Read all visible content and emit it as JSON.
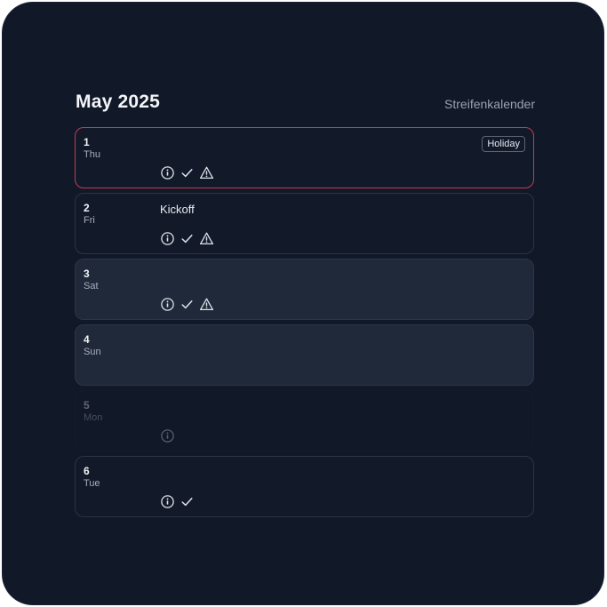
{
  "header": {
    "month_title": "May 2025",
    "app_label": "Streifenkalender"
  },
  "days": [
    {
      "num": "1",
      "weekday": "Thu",
      "event": "",
      "badge": "Holiday",
      "icons": [
        "info-icon",
        "check-icon",
        "warning-icon"
      ],
      "state": "holiday"
    },
    {
      "num": "2",
      "weekday": "Fri",
      "event": "Kickoff",
      "badge": "",
      "icons": [
        "info-icon",
        "check-icon",
        "warning-icon"
      ],
      "state": "normal"
    },
    {
      "num": "3",
      "weekday": "Sat",
      "event": "",
      "badge": "",
      "icons": [
        "info-icon",
        "check-icon",
        "warning-icon"
      ],
      "state": "weekend"
    },
    {
      "num": "4",
      "weekday": "Sun",
      "event": "",
      "badge": "",
      "icons": [],
      "state": "weekend"
    },
    {
      "num": "5",
      "weekday": "Mon",
      "event": "",
      "badge": "",
      "icons": [
        "info-icon"
      ],
      "state": "dim"
    },
    {
      "num": "6",
      "weekday": "Tue",
      "event": "",
      "badge": "",
      "icons": [
        "info-icon",
        "check-icon"
      ],
      "state": "normal"
    }
  ],
  "colors": {
    "background": "#111828",
    "weekend_row": "#1f2939",
    "holiday_border": "#c43c4e",
    "text": "#f1f3f7",
    "muted_text": "#a7afbd"
  }
}
